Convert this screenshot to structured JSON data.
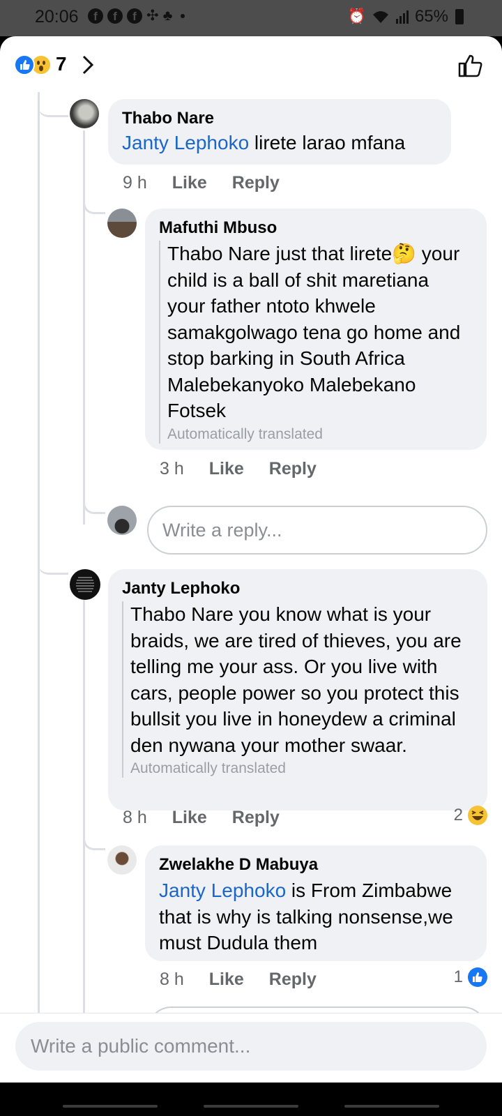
{
  "status_bar": {
    "time": "20:06",
    "battery": "65%"
  },
  "header": {
    "reaction_count": "7"
  },
  "comments": [
    {
      "author": "Thabo Nare",
      "mention": "Janty Lephoko",
      "text": " lirete larao mfana",
      "time": "9 h",
      "like": "Like",
      "reply": "Reply"
    },
    {
      "author": "Mafuthi Mbuso",
      "text": "Thabo Nare just that lirete🤔 your child is a ball of shit maretiana your father ntoto khwele samakgolwago tena go home and stop barking in South Africa Malebekanyoko Malebekano Fotsek",
      "translated": "Automatically translated",
      "time": "3 h",
      "like": "Like",
      "reply": "Reply"
    },
    {
      "author": "Janty Lephoko",
      "text": "Thabo Nare you know what is your braids, we are tired of thieves, you are telling me your ass. Or you live with cars, people power so you protect this bullsit you live in honeydew a criminal den nywana your mother swaar.",
      "translated": "Automatically translated",
      "time": "8 h",
      "like": "Like",
      "reply": "Reply",
      "reaction_count": "2"
    },
    {
      "author": "Zwelakhe D Mabuya",
      "mention": "Janty Lephoko",
      "text": " is From Zimbabwe that is why is talking nonsense,we must Dudula them",
      "time": "8 h",
      "like": "Like",
      "reply": "Reply",
      "reaction_count": "1"
    }
  ],
  "reply_input": {
    "placeholder": "Write a reply..."
  },
  "comment_bar": {
    "placeholder": "Write a public comment..."
  },
  "colors": {
    "link": "#1b66c9",
    "bubble": "#eff1f5",
    "like_blue": "#1877f2"
  }
}
